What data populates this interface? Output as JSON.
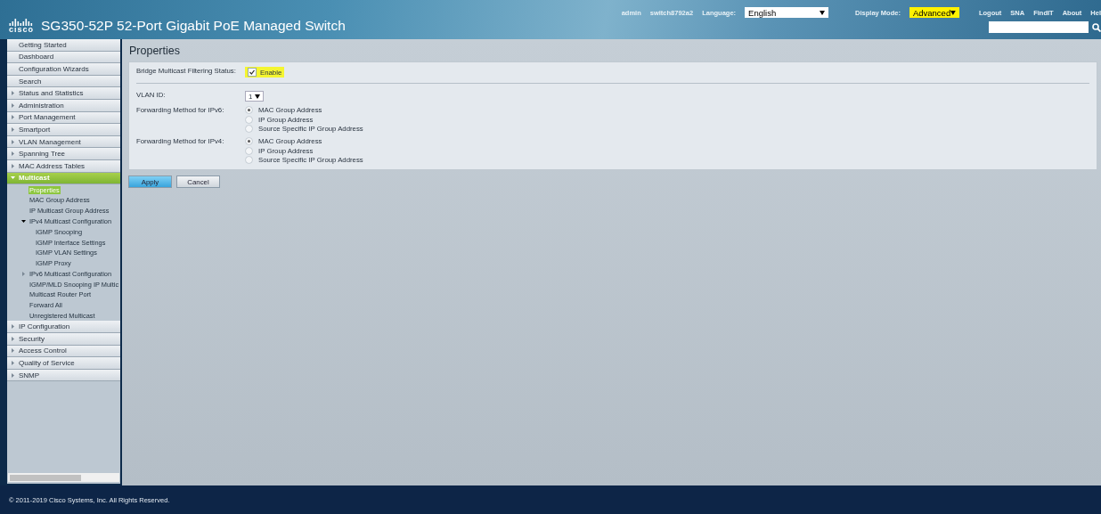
{
  "header": {
    "logo": "cisco",
    "title": "SG350-52P 52-Port Gigabit PoE Managed Switch",
    "user": "admin",
    "host": "switch8792a2",
    "language": {
      "label": "Language:",
      "value": "English"
    },
    "display_mode": {
      "label": "Display Mode:",
      "value": "Advanced",
      "highlighted": true
    },
    "links": [
      "Logout",
      "SNA",
      "FindIT",
      "About",
      "Hel"
    ]
  },
  "sidebar": {
    "items": [
      {
        "label": "Getting Started",
        "kind": "page",
        "selected": false
      },
      {
        "label": "Dashboard",
        "kind": "page",
        "selected": false
      },
      {
        "label": "Configuration Wizards",
        "kind": "page",
        "selected": false
      },
      {
        "label": "Search",
        "kind": "page",
        "selected": false
      },
      {
        "label": "Status and Statistics",
        "kind": "folder",
        "expanded": false,
        "selected": false
      },
      {
        "label": "Administration",
        "kind": "folder",
        "expanded": false,
        "selected": false
      },
      {
        "label": "Port Management",
        "kind": "folder",
        "expanded": false,
        "selected": false
      },
      {
        "label": "Smartport",
        "kind": "folder",
        "expanded": false,
        "selected": false
      },
      {
        "label": "VLAN Management",
        "kind": "folder",
        "expanded": false,
        "selected": false
      },
      {
        "label": "Spanning Tree",
        "kind": "folder",
        "expanded": false,
        "selected": false
      },
      {
        "label": "MAC Address Tables",
        "kind": "folder",
        "expanded": false,
        "selected": false
      },
      {
        "label": "Multicast",
        "kind": "folder",
        "expanded": true,
        "selected": false,
        "children": [
          {
            "label": "Properties",
            "kind": "page",
            "selected": true
          },
          {
            "label": "MAC Group Address",
            "kind": "page",
            "selected": false
          },
          {
            "label": "IP Multicast Group Address",
            "kind": "page",
            "selected": false
          },
          {
            "label": "IPv4 Multicast Configuration",
            "kind": "folder",
            "expanded": true,
            "selected": false,
            "children": [
              {
                "label": "IGMP Snooping",
                "kind": "page",
                "selected": false
              },
              {
                "label": "IGMP Interface Settings",
                "kind": "page",
                "selected": false
              },
              {
                "label": "IGMP VLAN Settings",
                "kind": "page",
                "selected": false
              },
              {
                "label": "IGMP Proxy",
                "kind": "page",
                "selected": false
              }
            ]
          },
          {
            "label": "IPv6 Multicast Configuration",
            "kind": "folder",
            "expanded": false,
            "selected": false
          },
          {
            "label": "IGMP/MLD Snooping IP Multic",
            "kind": "page",
            "selected": false
          },
          {
            "label": "Multicast Router Port",
            "kind": "page",
            "selected": false
          },
          {
            "label": "Forward All",
            "kind": "page",
            "selected": false
          },
          {
            "label": "Unregistered Multicast",
            "kind": "page",
            "selected": false
          }
        ]
      },
      {
        "label": "IP Configuration",
        "kind": "folder",
        "expanded": false,
        "selected": false
      },
      {
        "label": "Security",
        "kind": "folder",
        "expanded": false,
        "selected": false
      },
      {
        "label": "Access Control",
        "kind": "folder",
        "expanded": false,
        "selected": false
      },
      {
        "label": "Quality of Service",
        "kind": "folder",
        "expanded": false,
        "selected": false
      },
      {
        "label": "SNMP",
        "kind": "folder",
        "expanded": false,
        "selected": false
      }
    ]
  },
  "page": {
    "title": "Properties",
    "filtering": {
      "label": "Bridge Multicast Filtering Status:",
      "option": "Enable",
      "checked": true,
      "highlighted": true
    },
    "vlan": {
      "label": "VLAN ID:",
      "value": "1"
    },
    "methods": [
      {
        "label": "Forwarding Method for IPv6:",
        "options": [
          {
            "label": "MAC Group Address",
            "selected": true
          },
          {
            "label": "IP Group Address",
            "selected": false
          },
          {
            "label": "Source Specific IP Group Address",
            "selected": false
          }
        ]
      },
      {
        "label": "Forwarding Method for IPv4:",
        "options": [
          {
            "label": "MAC Group Address",
            "selected": true
          },
          {
            "label": "IP Group Address",
            "selected": false
          },
          {
            "label": "Source Specific IP Group Address",
            "selected": false
          }
        ]
      }
    ]
  },
  "buttons": [
    {
      "label": "Apply",
      "kind": "primary"
    },
    {
      "label": "Cancel",
      "kind": "secondary"
    }
  ],
  "footer": "© 2011-2019 Cisco Systems, Inc. All Rights Reserved."
}
